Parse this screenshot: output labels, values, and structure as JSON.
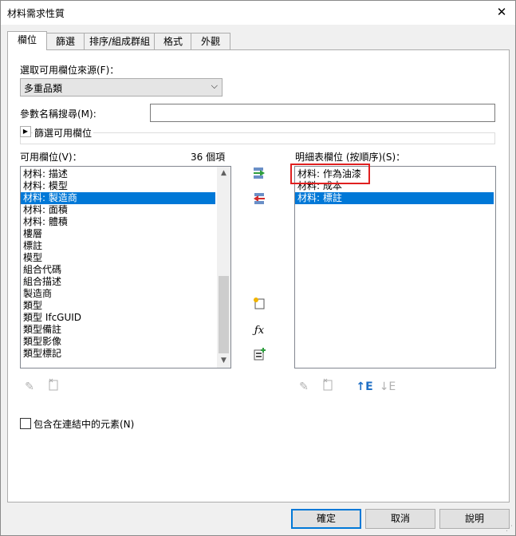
{
  "window": {
    "title": "材料需求性質"
  },
  "tabs": [
    "欄位",
    "篩選",
    "排序/組成群組",
    "格式",
    "外觀"
  ],
  "source": {
    "label": "選取可用欄位來源(F)：",
    "selected": "多重品類"
  },
  "param_search": {
    "label": "參數名稱搜尋(M):",
    "value": ""
  },
  "filter_group": {
    "label": "篩選可用欄位"
  },
  "available": {
    "label": "可用欄位(V)：",
    "count": "36 個項",
    "items": [
      "材料: 描述",
      "材料: 模型",
      "材料: 製造商",
      "材料: 面積",
      "材料: 體積",
      "樓層",
      "標註",
      "模型",
      "組合代碼",
      "組合描述",
      "製造商",
      "類型",
      "類型 IfcGUID",
      "類型備註",
      "類型影像",
      "類型標記"
    ],
    "selected_index": 2
  },
  "scheduled": {
    "label": "明細表欄位 (按順序)(S)：",
    "items": [
      "材料: 作為油漆",
      "材料: 成本",
      "材料: 標註"
    ],
    "selected_index": 2
  },
  "include_linked": {
    "label": "包含在連結中的元素(N)",
    "checked": false
  },
  "buttons": {
    "ok": "確定",
    "cancel": "取消",
    "help": "說明"
  },
  "icons": {
    "close": "close-icon",
    "add": "add-parameter-icon",
    "remove": "remove-parameter-icon",
    "new_param": "new-parameter-icon",
    "formula": "formula-icon",
    "combine": "combine-parameters-icon",
    "edit": "edit-icon",
    "delete": "delete-icon",
    "move_up": "move-up-icon",
    "move_down": "move-down-icon"
  }
}
